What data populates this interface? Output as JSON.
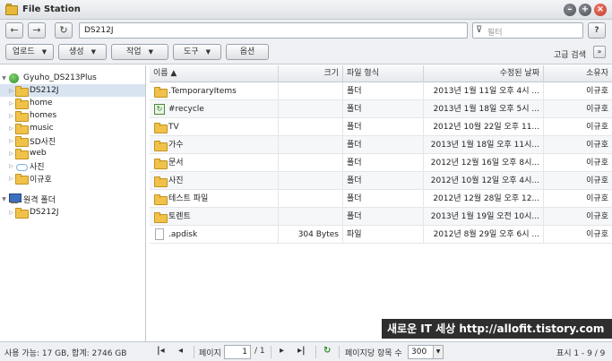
{
  "window": {
    "title": "File Station"
  },
  "address": {
    "path": "DS212J",
    "filter_placeholder": "필터"
  },
  "toolbar": {
    "buttons": [
      "업로드",
      "생성",
      "작업",
      "도구",
      "옵션"
    ],
    "advanced_search": "고급 검색"
  },
  "tree": {
    "root": "Gyuho_DS213Plus",
    "items": [
      "DS212J",
      "home",
      "homes",
      "music",
      "SD사진",
      "web",
      "사진",
      "이규호"
    ],
    "remote": "원격 폴더",
    "remote_items": [
      "DS212J"
    ]
  },
  "table": {
    "headers": [
      "이름 ▲",
      "크기",
      "파일 형식",
      "수정된 날짜",
      "소유자"
    ],
    "rows": [
      {
        "name": ".TemporaryItems",
        "size": "",
        "type": "폴더",
        "date": "2013년 1월 11일 오후 4시 ...",
        "owner": "이규호",
        "icon": "folder-icon"
      },
      {
        "name": "#recycle",
        "size": "",
        "type": "폴더",
        "date": "2013년 1월 18일 오후 5시 ...",
        "owner": "이규호",
        "icon": "recycle-icon"
      },
      {
        "name": "TV",
        "size": "",
        "type": "폴더",
        "date": "2012년 10월 22일 오후 11...",
        "owner": "이규호",
        "icon": "folder-icon"
      },
      {
        "name": "가수",
        "size": "",
        "type": "폴더",
        "date": "2013년 1월 18일 오후 11시...",
        "owner": "이규호",
        "icon": "folder-icon"
      },
      {
        "name": "문서",
        "size": "",
        "type": "폴더",
        "date": "2012년 12월 16일 오후 8시...",
        "owner": "이규호",
        "icon": "folder-icon"
      },
      {
        "name": "사진",
        "size": "",
        "type": "폴더",
        "date": "2012년 10월 12일 오후 4시...",
        "owner": "이규호",
        "icon": "folder-icon"
      },
      {
        "name": "테스트 파일",
        "size": "",
        "type": "폴더",
        "date": "2012년 12월 28일 오후 12...",
        "owner": "이규호",
        "icon": "folder-icon"
      },
      {
        "name": "토렌트",
        "size": "",
        "type": "폴더",
        "date": "2013년 1월 19일 오전 10시...",
        "owner": "이규호",
        "icon": "folder-icon"
      },
      {
        "name": ".apdisk",
        "size": "304 Bytes",
        "type": "파일",
        "date": "2012년 8월 29일 오후 6시 ...",
        "owner": "이규호",
        "icon": "file-icon"
      }
    ]
  },
  "status": {
    "storage": "사용 가능: 17 GB, 합계: 2746 GB",
    "page_label": "페이지",
    "page_value": "1",
    "page_total": "/ 1",
    "per_page_label": "페이지당 항목 수",
    "per_page_value": "300",
    "display": "표시 1 - 9 / 9"
  },
  "watermark": {
    "text": "새로운 IT 세상 http://allofit.tistory.com"
  }
}
